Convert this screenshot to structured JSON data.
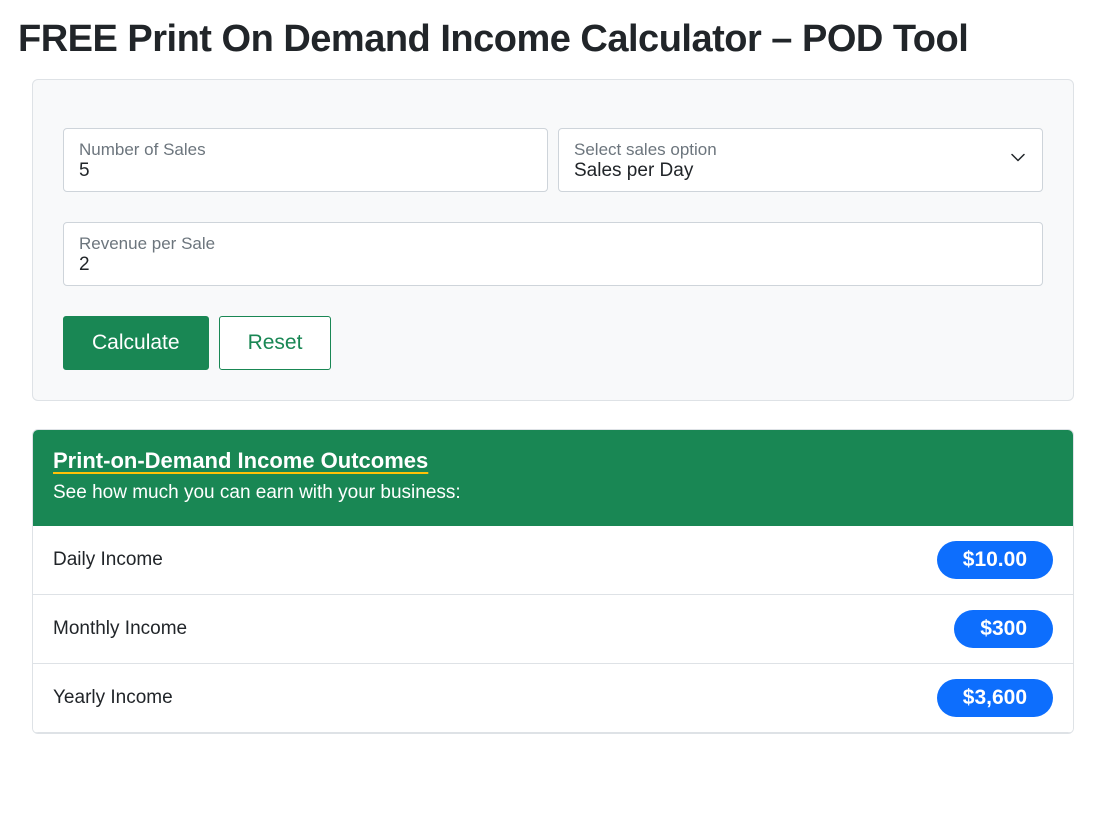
{
  "page_title": "FREE Print On Demand Income Calculator – POD Tool",
  "form": {
    "number_of_sales": {
      "label": "Number of Sales",
      "value": "5"
    },
    "sales_option": {
      "label": "Select sales option",
      "value": "Sales per Day"
    },
    "revenue_per_sale": {
      "label": "Revenue per Sale",
      "value": "2"
    },
    "calculate_label": "Calculate",
    "reset_label": "Reset"
  },
  "results": {
    "heading": "Print-on-Demand Income Outcomes",
    "subheading": "See how much you can earn with your business:",
    "rows": [
      {
        "label": "Daily Income",
        "value": "$10.00"
      },
      {
        "label": "Monthly Income",
        "value": "$300"
      },
      {
        "label": "Yearly Income",
        "value": "$3,600"
      }
    ]
  },
  "colors": {
    "accent_green": "#198754",
    "accent_blue": "#0d6efd",
    "underline_yellow": "#ffc107"
  }
}
